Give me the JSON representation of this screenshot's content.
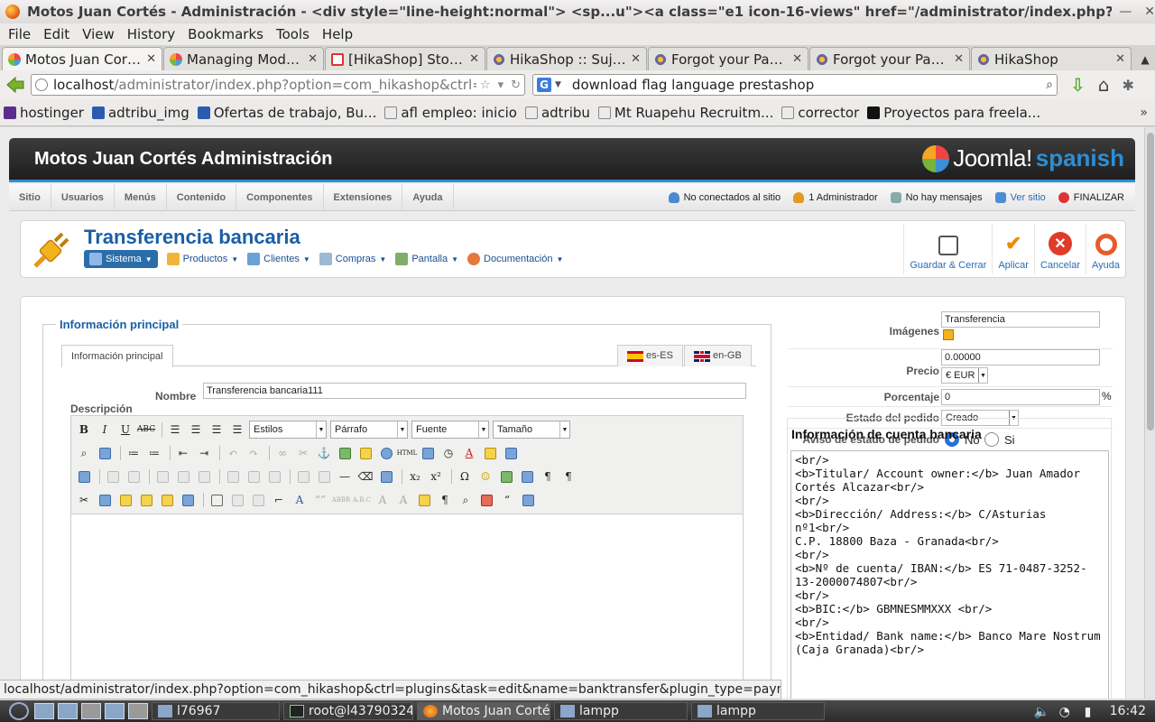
{
  "window": {
    "title": "Motos Juan Cortés - Administración - <div style=\"line-height:normal\"> <sp...u\"><a class=\"e1 icon-16-views\" href=\"/administrator/index.php?option=co"
  },
  "menubar": [
    "File",
    "Edit",
    "View",
    "History",
    "Bookmarks",
    "Tools",
    "Help"
  ],
  "tabs": [
    {
      "label": "Motos Juan Cortés - A...",
      "icon": "joomla-icon",
      "active": true
    },
    {
      "label": "Managing Modules...",
      "icon": "joomla-icon",
      "active": false
    },
    {
      "label": "[HikaShop] Store o...",
      "icon": "gmail-icon",
      "active": false
    },
    {
      "label": "HikaShop :: Sujet :...",
      "icon": "hikashop-icon",
      "active": false
    },
    {
      "label": "Forgot your Passwo...",
      "icon": "hikashop-icon",
      "active": false
    },
    {
      "label": "Forgot your Passwo...",
      "icon": "hikashop-icon",
      "active": false
    },
    {
      "label": "HikaShop",
      "icon": "hikashop-icon",
      "active": false
    }
  ],
  "url": {
    "host": "localhost",
    "path": "/administrator/index.php?option=com_hikashop&ctrl=plug"
  },
  "search": {
    "engine": "G",
    "value": "download flag language prestashop"
  },
  "bookmarks": [
    {
      "label": "hostinger",
      "icon": "h"
    },
    {
      "label": "adtribu_img",
      "icon": "blue"
    },
    {
      "label": "Ofertas de trabajo, Bu...",
      "icon": "blue"
    },
    {
      "label": "afl empleo: inicio",
      "icon": ""
    },
    {
      "label": "adtribu",
      "icon": ""
    },
    {
      "label": "Mt Ruapehu Recruitm...",
      "icon": ""
    },
    {
      "label": "corrector",
      "icon": ""
    },
    {
      "label": "Proyectos para freela...",
      "icon": "black"
    }
  ],
  "joomla": {
    "site_title": "Motos Juan Cortés Administración",
    "logo_text": "Joomla!",
    "logo_lang": "spanish",
    "admin_menu": [
      "Sitio",
      "Usuarios",
      "Menús",
      "Contenido",
      "Componentes",
      "Extensiones",
      "Ayuda"
    ],
    "status": {
      "visitors": "No conectados al sitio",
      "admins": "1 Administrador",
      "messages": "No hay mensajes",
      "view_site": "Ver sitio",
      "logout": "FINALIZAR"
    }
  },
  "toolbar": {
    "page_title": "Transferencia bancaria",
    "submenu": [
      "Sistema",
      "Productos",
      "Clientes",
      "Compras",
      "Pantalla",
      "Documentación"
    ],
    "buttons": [
      "Guardar & Cerrar",
      "Aplicar",
      "Cancelar",
      "Ayuda"
    ]
  },
  "form": {
    "legend": "Información principal",
    "tab_main": "Información principal",
    "lang_tabs": [
      "es-ES",
      "en-GB"
    ],
    "nombre_label": "Nombre",
    "nombre_value": "Transferencia bancaria111",
    "descripcion_label": "Descripción",
    "editor_selects": [
      "Estilos",
      "Párrafo",
      "Fuente",
      "Tamaño"
    ]
  },
  "right": {
    "imagenes_label": "Imágenes",
    "imagenes_value": "Transferencia",
    "precio_label": "Precio",
    "precio_value": "0.00000",
    "currency": "€ EUR",
    "porcentaje_label": "Porcentaje",
    "porcentaje_value": "0",
    "percent_sign": "%",
    "estado_label": "Estado del pedido",
    "estado_value": "Creado",
    "aviso_label": "Aviso de estado de pedido",
    "aviso_no": "No",
    "aviso_si": "Si",
    "aviso_selected": "No",
    "bank_title": "Información de cuenta bancaria",
    "bank_text": "<br/>\n<b>Titular/ Account owner:</b> Juan Amador Cortés Alcazar<br/>\n<br/>\n<b>Dirección/ Address:</b> C/Asturias nº1<br/>\nC.P. 18800 Baza - Granada<br/>\n<br/>\n<b>Nº de cuenta/ IBAN:</b> ES 71-0487-3252-13-2000074807<br/>\n<br/>\n<b>BIC:</b> GBMNESMMXXX <br/>\n<br/>\n<b>Entidad/ Bank name:</b> Banco Mare Nostrum (Caja Granada)<br/>"
  },
  "statusbar": "localhost/administrator/index.php?option=com_hikashop&ctrl=plugins&task=edit&name=banktransfer&plugin_type=payment#",
  "taskbar": {
    "tasks": [
      {
        "label": "l76967",
        "icon": "folder"
      },
      {
        "label": "root@l43790324...",
        "icon": "term"
      },
      {
        "label": "Motos Juan Corté...",
        "icon": "ff",
        "active": true
      },
      {
        "label": "lampp",
        "icon": "folder"
      },
      {
        "label": "lampp",
        "icon": "folder"
      }
    ],
    "clock": "16:42"
  }
}
